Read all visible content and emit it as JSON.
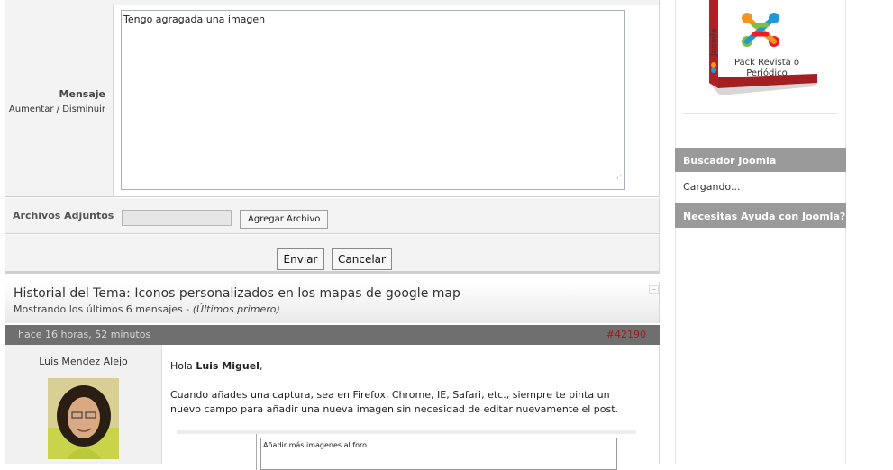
{
  "form": {
    "message_label": "Mensaje",
    "increase_link": "Aumentar",
    "separator": "/",
    "decrease_link": "Disminuir",
    "message_value": "Tengo agragada una imagen",
    "attachments_label": "Archivos Adjuntos",
    "add_file_button": "Agregar Archivo",
    "send_button": "Enviar",
    "cancel_button": "Cancelar"
  },
  "history": {
    "title": "Historial del Tema: Iconos personalizados en los mapas de google map",
    "subtitle": "Mostrando los últimos 6 mensajes -",
    "subtitle_order": "(Últimos primero)"
  },
  "post": {
    "time": "hace 16 horas, 52 minutos",
    "id": "#42190",
    "author": "Luis Mendez Alejo",
    "greeting_prefix": "Hola",
    "greeting_name": "Luis Miguel",
    "greeting_suffix": ",",
    "body": "Cuando añades una captura, sea en Firefox, Chrome, IE, Safari, etc., siempre te pinta un nuevo campo para añadir una nueva imagen sin necesidad de editar nuevamente el post.",
    "screenshot_text": "Añadir más imagenes al foro....."
  },
  "sidebar": {
    "product_brand": "Joomla",
    "product_label": "Pack Revista o Periódico",
    "widget1_title": "Buscador Joomla",
    "widget1_loading": "Cargando...",
    "widget2_title": "Necesitas Ayuda con Joomla?"
  },
  "colors": {
    "joomla_orange": "#f7941d",
    "joomla_blue": "#1c9ad6",
    "joomla_green": "#7ac143",
    "joomla_red": "#ed1c24",
    "post_id": "#9b1b1b",
    "widget_header": "#9a9a9a"
  }
}
